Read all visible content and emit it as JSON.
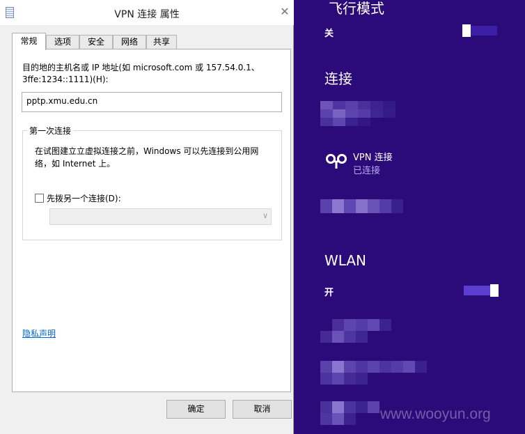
{
  "dialog": {
    "title": "VPN 连接 属性",
    "close_glyph": "✕",
    "tabs": [
      "常规",
      "选项",
      "安全",
      "网络",
      "共享"
    ],
    "host_label": "目的地的主机名或 IP 地址(如 microsoft.com 或 157.54.0.1、3ffe:1234::1111)(H):",
    "host_value": "pptp.xmu.edu.cn",
    "first_connect": {
      "legend": "第一次连接",
      "description": "在试图建立立虚拟连接之前，Windows 可以先连接到公用网络，如 Internet 上。",
      "checkbox_label": "先拨另一个连接(D):",
      "select_value": ""
    },
    "privacy_link": "隐私声明",
    "ok_label": "确定",
    "cancel_label": "取消"
  },
  "charms": {
    "airplane_heading": "飞行模式",
    "airplane_state": "关",
    "connections_heading": "连接",
    "vpn_name": "VPN 连接",
    "vpn_status": "已连接",
    "wlan_heading": "WLAN",
    "wlan_state": "开",
    "watermark": "www.wooyun.org"
  },
  "colors": {
    "charms_bg": "#2b0a7a",
    "link": "#0066cc",
    "status_text": "#b9a9ee"
  }
}
